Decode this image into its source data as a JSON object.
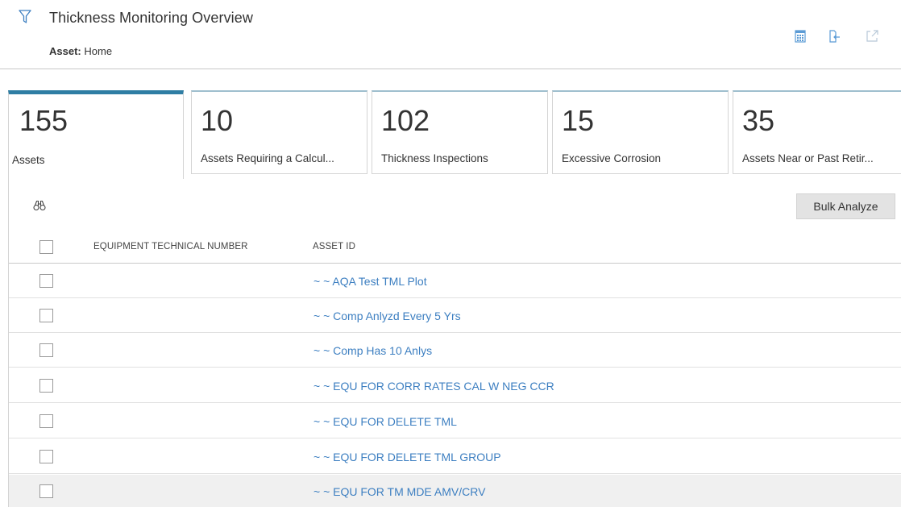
{
  "header": {
    "title": "Thickness Monitoring Overview",
    "asset_label": "Asset:",
    "asset_value": "Home",
    "icons": [
      "filter-icon",
      "calendar-icon",
      "export-icon",
      "open-external-icon"
    ]
  },
  "tabs": [
    {
      "count": "155",
      "label": "Assets",
      "active": true
    },
    {
      "count": "10",
      "label": "Assets Requiring a Calcul...",
      "active": false
    },
    {
      "count": "102",
      "label": "Thickness Inspections",
      "active": false
    },
    {
      "count": "15",
      "label": "Excessive Corrosion",
      "active": false
    },
    {
      "count": "35",
      "label": "Assets Near or Past Retir...",
      "active": false
    }
  ],
  "toolbar": {
    "search_icon": "binoculars-icon",
    "bulk_analyze_label": "Bulk Analyze"
  },
  "table": {
    "columns": [
      "EQUIPMENT TECHNICAL NUMBER",
      "ASSET ID"
    ],
    "rows": [
      {
        "equipment_technical_number": "",
        "asset_id": "~ ~ AQA Test TML Plot"
      },
      {
        "equipment_technical_number": "",
        "asset_id": "~ ~ Comp Anlyzd Every 5 Yrs"
      },
      {
        "equipment_technical_number": "",
        "asset_id": "~ ~ Comp Has 10 Anlys"
      },
      {
        "equipment_technical_number": "",
        "asset_id": "~ ~ EQU FOR CORR RATES CAL W NEG CCR"
      },
      {
        "equipment_technical_number": "",
        "asset_id": "~ ~ EQU FOR DELETE TML"
      },
      {
        "equipment_technical_number": "",
        "asset_id": "~ ~ EQU FOR DELETE TML GROUP"
      },
      {
        "equipment_technical_number": "",
        "asset_id": "~ ~ EQU FOR TM MDE AMV/CRV"
      }
    ]
  },
  "colors": {
    "accent": "#2f7ea4",
    "link": "#3d7fc1",
    "icon": "#5b9bd5",
    "tab_border_top": "#9fbfce"
  }
}
